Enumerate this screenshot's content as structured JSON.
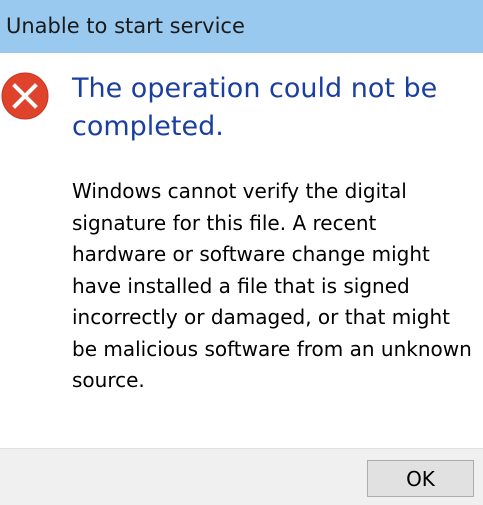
{
  "window": {
    "title": "Unable to start service"
  },
  "content": {
    "icon": "error-x-icon",
    "heading": "The operation could not be completed.",
    "message": "Windows cannot verify the digital signature for this file. A recent hardware or software change might have installed a file that is signed incorrectly or damaged, or that might be malicious software from an unknown source."
  },
  "buttons": {
    "ok_label": "OK"
  },
  "colors": {
    "titlebar": "#99c9ef",
    "heading": "#1b3f9e",
    "error_icon": "#e0432c",
    "footer": "#f0f0f0"
  }
}
